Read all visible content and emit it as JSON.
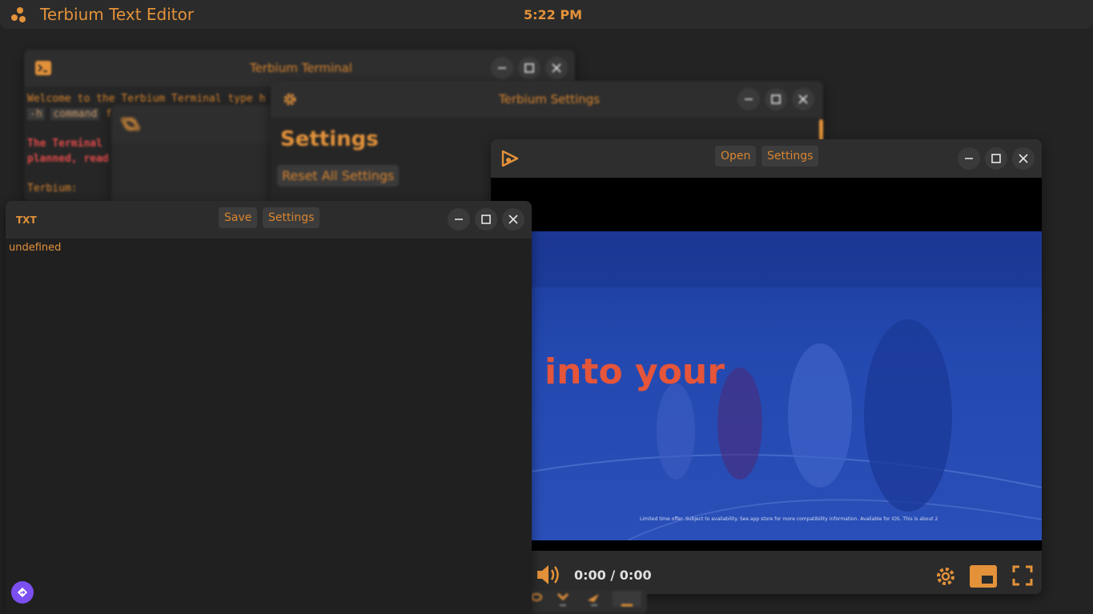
{
  "topbar": {
    "app_title": "Terbium Text Editor",
    "clock": "5:22 PM"
  },
  "terminal": {
    "title": "Terbium Terminal",
    "line1": "Welcome to the Terbium Terminal type h",
    "line2_cmd": "-h",
    "line2_code": "command",
    "line2_rest": "f",
    "line3": "The Terminal",
    "line4": "planned, read",
    "prompt": "Terbium:"
  },
  "settings": {
    "title": "Terbium Settings",
    "heading": "Settings",
    "reset_label": "Reset All Settings"
  },
  "video_player": {
    "open_label": "Open",
    "settings_label": "Settings",
    "overlay_text": "into your",
    "fine_print": "Limited time offer. Subject to availability. See app store for more compatibility information. Available for iOS. This is about 2",
    "time": "0:00 / 0:00"
  },
  "editor": {
    "badge": "TXT",
    "save_label": "Save",
    "settings_label": "Settings",
    "content": "undefined"
  },
  "colors": {
    "accent": "#e3923a",
    "background": "#232323",
    "assistant": "#7b4ff0"
  }
}
